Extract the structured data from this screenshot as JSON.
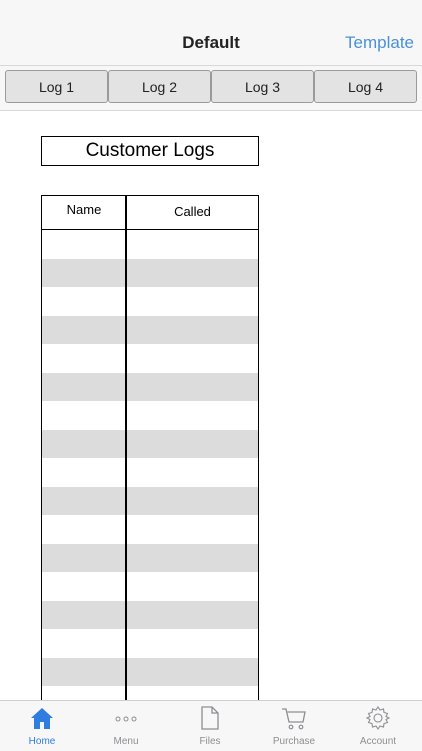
{
  "navbar": {
    "title": "Default",
    "right_action": "Template"
  },
  "log_tabs": [
    "Log 1",
    "Log 2",
    "Log 3",
    "Log 4"
  ],
  "card": {
    "title": "Customer Logs"
  },
  "table": {
    "columns": [
      "Name",
      "Called"
    ]
  },
  "tabbar": {
    "items": [
      {
        "label": "Home",
        "icon": "home-icon",
        "active": true
      },
      {
        "label": "Menu",
        "icon": "more-icon",
        "active": false
      },
      {
        "label": "Files",
        "icon": "file-icon",
        "active": false
      },
      {
        "label": "Purchase",
        "icon": "cart-icon",
        "active": false
      },
      {
        "label": "Account",
        "icon": "gear-icon",
        "active": false
      }
    ]
  },
  "colors": {
    "accent": "#2f7de1",
    "link": "#4a90d9",
    "stripe": "#dcdcdc"
  }
}
